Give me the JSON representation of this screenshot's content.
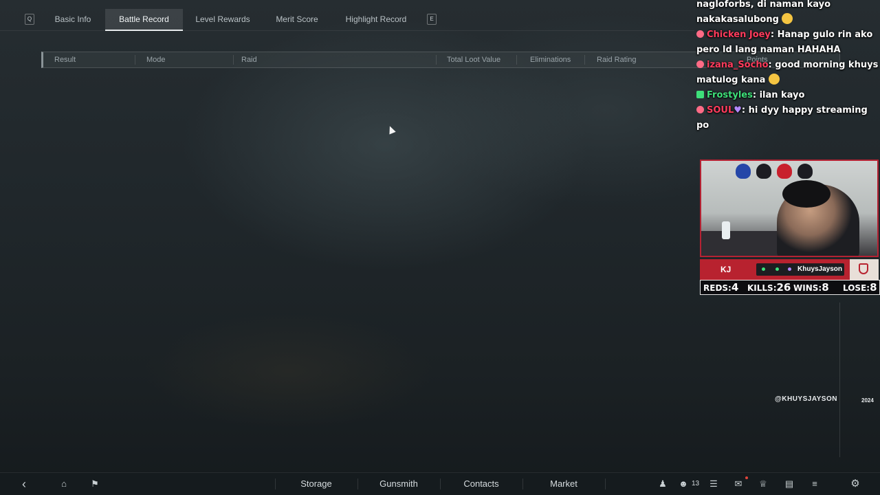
{
  "tabs": {
    "prev_key": "Q",
    "next_key": "E",
    "items": [
      {
        "label": "Basic Info"
      },
      {
        "label": "Battle Record"
      },
      {
        "label": "Level Rewards"
      },
      {
        "label": "Merit Score"
      },
      {
        "label": "Highlight Record"
      }
    ],
    "active": "Battle Record"
  },
  "table": {
    "columns": [
      "Result",
      "Mode",
      "Raid",
      "Total Loot Value",
      "Eliminations",
      "Raid Rating",
      "Points"
    ]
  },
  "chat": {
    "messages": [
      {
        "user": "",
        "text": "nagloforbs, di naman kayo nakakasalubong",
        "user_color": "#ffffff"
      },
      {
        "user": "Chicken Joey",
        "text": "Hanap gulo rin ako pero ld lang naman HAHAHA",
        "user_color": "#ff3b5c"
      },
      {
        "user": "izana_Socho",
        "text": "good morning khuys matulog kana",
        "user_color": "#ff3b5c"
      },
      {
        "user": "Frostyles",
        "text": "ilan kayo",
        "user_color": "#3ee07a"
      },
      {
        "user": "SOUL",
        "text": "hi dyy happy streaming po",
        "user_color": "#ff3b5c"
      }
    ]
  },
  "overlay": {
    "initials": "KJ",
    "streamer_name": "KhuysJayson",
    "stats": [
      {
        "label": "REDS:",
        "value": "4"
      },
      {
        "label": "KILLS:",
        "value": "26"
      },
      {
        "label": "WINS:",
        "value": "8"
      },
      {
        "label": "LOSE:",
        "value": "8"
      }
    ],
    "handle": "@KHUYSJAYSON",
    "year": "2024"
  },
  "bottom_nav": {
    "items": [
      "Storage",
      "Gunsmith",
      "Contacts",
      "Market"
    ],
    "friends_count": "13"
  },
  "icons": {
    "back": "back-arrow-icon",
    "home": "home-icon",
    "flag": "flag-icon",
    "team": "team-icon",
    "friends": "friends-icon",
    "chat": "chat-icon",
    "mail": "mail-icon",
    "trophy": "trophy-icon",
    "notes": "notes-icon",
    "menu": "menu-icon",
    "settings": "settings-icon"
  },
  "colors": {
    "accent_red": "#b8222f",
    "chat_red": "#ff3b5c",
    "chat_green": "#3ee07a"
  }
}
